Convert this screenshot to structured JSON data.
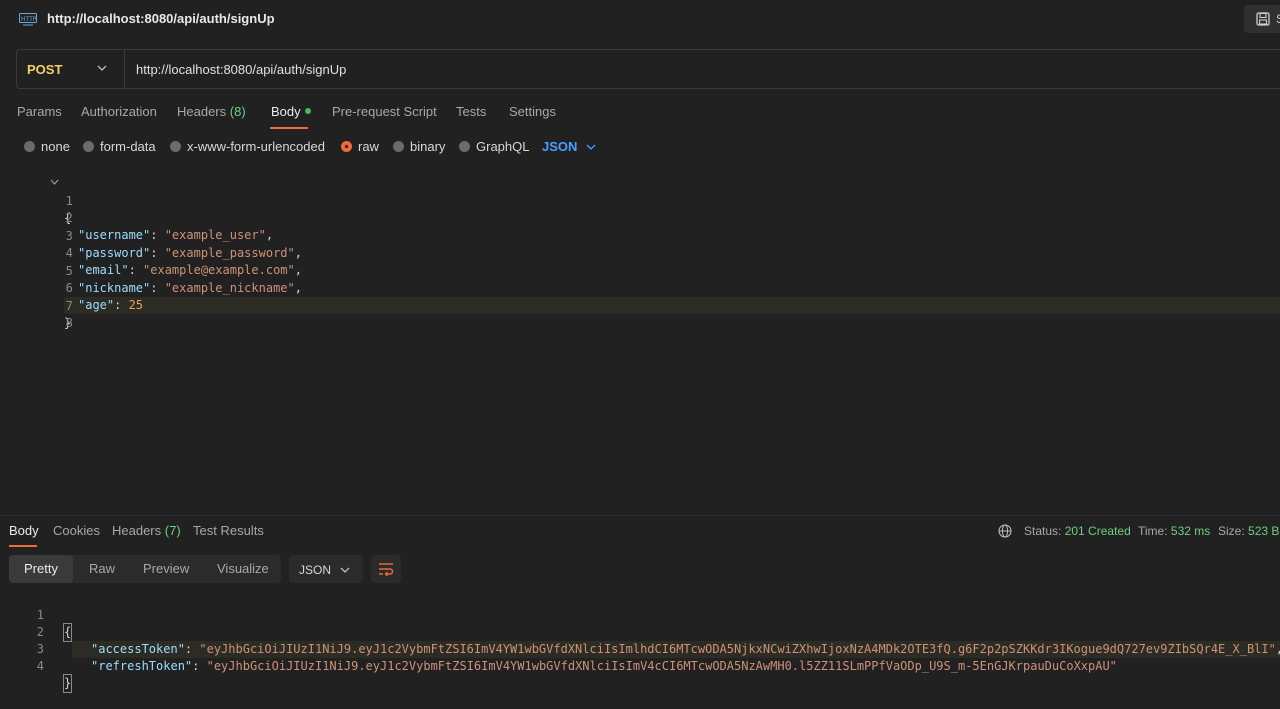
{
  "window": {
    "title": "http://localhost:8080/api/auth/signUp",
    "save_label": "S"
  },
  "request": {
    "method": "POST",
    "url": "http://localhost:8080/api/auth/signUp",
    "tabs": [
      {
        "label": "Params"
      },
      {
        "label": "Authorization"
      },
      {
        "label": "Headers",
        "count": "(8)"
      },
      {
        "label": "Body"
      },
      {
        "label": "Pre-request Script"
      },
      {
        "label": "Tests"
      },
      {
        "label": "Settings"
      }
    ],
    "body_types": [
      "none",
      "form-data",
      "x-www-form-urlencoded",
      "raw",
      "binary",
      "GraphQL"
    ],
    "selected_body_type": "raw",
    "language": "JSON",
    "body_lines": [
      {
        "n": "1",
        "open": "{"
      },
      {
        "n": "2",
        "key": "\"username\"",
        "sep": ": ",
        "val": "\"example_user\"",
        "end": ","
      },
      {
        "n": "3",
        "key": "\"password\"",
        "sep": ": ",
        "val": "\"example_password\"",
        "end": ","
      },
      {
        "n": "4",
        "key": "\"email\"",
        "sep": ": ",
        "val": "\"example@example.com\"",
        "end": ","
      },
      {
        "n": "5",
        "key": "\"nickname\"",
        "sep": ": ",
        "val": "\"example_nickname\"",
        "end": ","
      },
      {
        "n": "6",
        "key": "\"age\"",
        "sep": ": ",
        "num": "25"
      },
      {
        "n": "7",
        "close": "}"
      },
      {
        "n": "8"
      }
    ]
  },
  "response": {
    "tabs": [
      {
        "label": "Body"
      },
      {
        "label": "Cookies"
      },
      {
        "label": "Headers",
        "count": "(7)"
      },
      {
        "label": "Test Results"
      }
    ],
    "status_label": "Status:",
    "status_value": "201 Created",
    "time_label": "Time:",
    "time_value": "532 ms",
    "size_label": "Size:",
    "size_value": "523 B",
    "views": [
      "Pretty",
      "Raw",
      "Preview",
      "Visualize"
    ],
    "format": "JSON",
    "lines": [
      {
        "n": "1",
        "open": "{"
      },
      {
        "n": "2",
        "key": "\"accessToken\"",
        "sep": ": ",
        "val": "\"eyJhbGciOiJIUzI1NiJ9.eyJ1c2VybmFtZSI6ImV4YW1wbGVfdXNlciIsImlhdCI6MTcwODA5NjkxNCwiZXhwIjoxNzA4MDk2OTE3fQ.g6F2p2pSZKKdr3IKogue9dQ727ev9ZIbSQr4E_X_BlI\"",
        "end": ","
      },
      {
        "n": "3",
        "key": "\"refreshToken\"",
        "sep": ": ",
        "val": "\"eyJhbGciOiJIUzI1NiJ9.eyJ1c2VybmFtZSI6ImV4YW1wbGVfdXNlciIsImV4cCI6MTcwODA5NzAwMH0.l5ZZ11SLmPPfVaODp_U9S_m-5EnGJKrpauDuCoXxpAU\""
      },
      {
        "n": "4",
        "close": "}"
      }
    ]
  },
  "colors": {
    "accent": "#f26b3a",
    "method": "#f2d26b",
    "success": "#6fcf7f",
    "json_link": "#4a9eff"
  }
}
